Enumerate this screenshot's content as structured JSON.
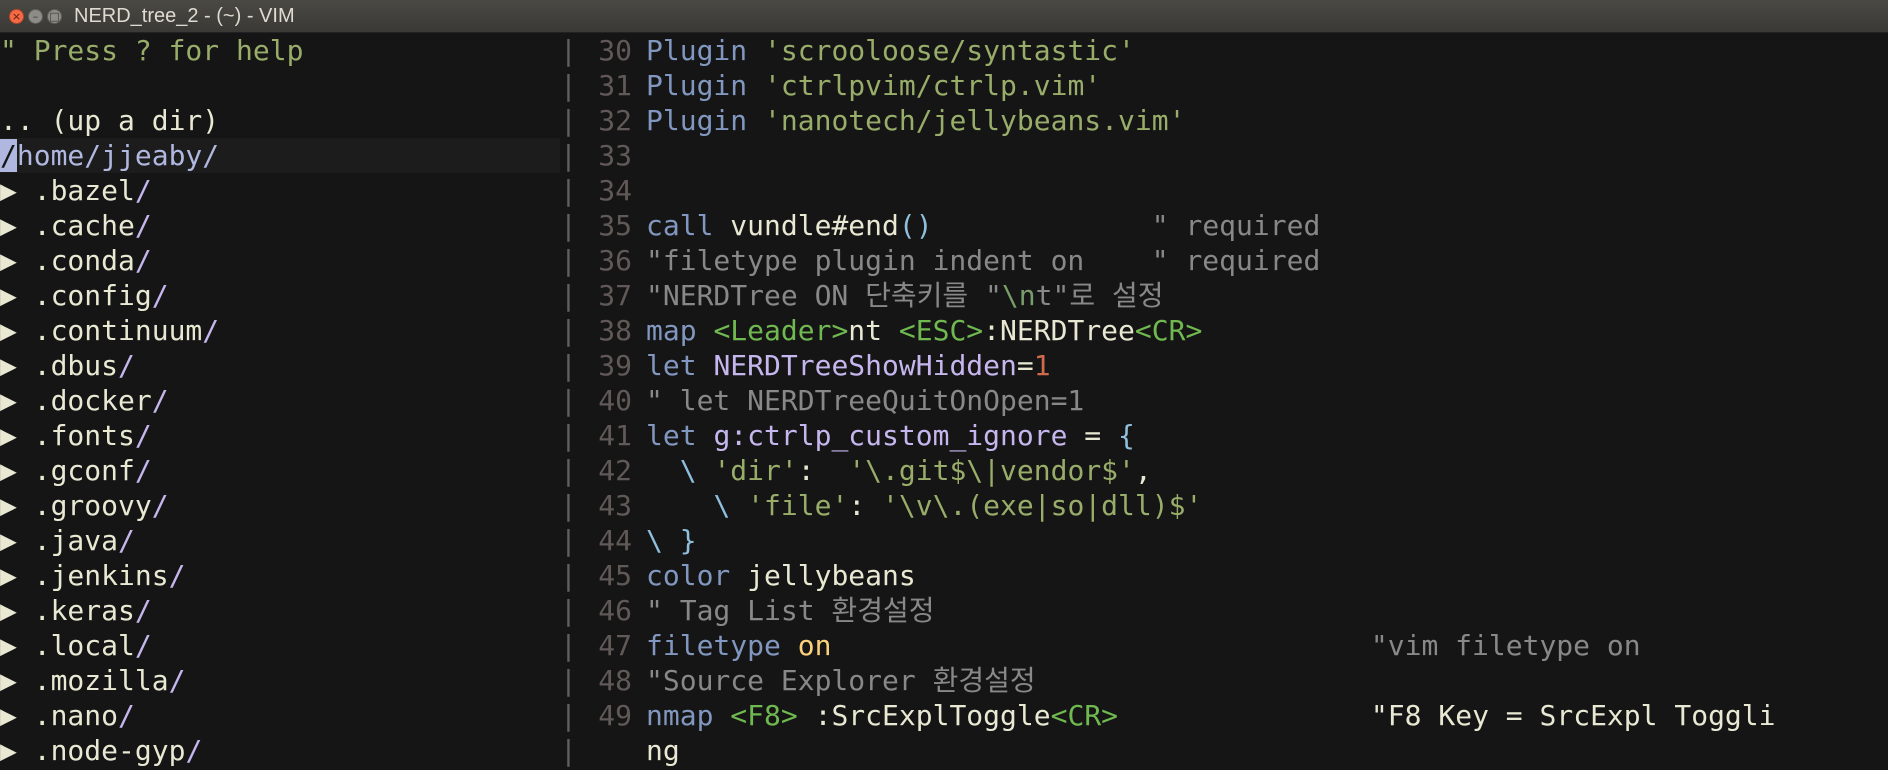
{
  "window": {
    "title": "NERD_tree_2 - (~) - VIM",
    "close_glyph": "×",
    "min_glyph": "–",
    "max_glyph": "□"
  },
  "tree": {
    "help_line": "\" Press ? for help",
    "up_dir": ".. (up a dir)",
    "root_cursor": "/",
    "root_rest": "home/jjeaby/",
    "arrow": "▶",
    "dirs": [
      ".bazel",
      ".cache",
      ".conda",
      ".config",
      ".continuum",
      ".dbus",
      ".docker",
      ".fonts",
      ".gconf",
      ".groovy",
      ".java",
      ".jenkins",
      ".keras",
      ".local",
      ".mozilla",
      ".nano",
      ".node-gyp"
    ]
  },
  "separator_char": "|",
  "code": {
    "line_numbers": [
      "30",
      "31",
      "32",
      "33",
      "34",
      "35",
      "36",
      "37",
      "38",
      "39",
      "40",
      "41",
      "42",
      "43",
      "44",
      "45",
      "46",
      "47",
      "48",
      "49",
      ""
    ],
    "l30": {
      "kw": "Plugin",
      "str": "'scrooloose/syntastic'"
    },
    "l31": {
      "kw": "Plugin",
      "str": "'ctrlpvim/ctrlp.vim'"
    },
    "l32": {
      "kw": "Plugin",
      "str": "'nanotech/jellybeans.vim'"
    },
    "l35": {
      "kw": "call",
      "fn": "vundle#end",
      "paren": "()",
      "cmt": "\" required"
    },
    "l36": {
      "cmt": "\"filetype plugin indent on    \" required"
    },
    "l37": {
      "cmt_a": "\"NERDTree ON 단축키를 \"",
      "esc": "\\n",
      "cmt_b": "t\"로 설정"
    },
    "l38": {
      "kw": "map",
      "tag1": "<Leader>",
      "plain1": "nt",
      "tag2": "<ESC>",
      "plain2": ":NERDTree",
      "tag3": "<CR>"
    },
    "l39": {
      "kw": "let",
      "var": "NERDTreeShowHidden",
      "op": "=",
      "num": "1"
    },
    "l40": {
      "cmt": "\" let NERDTreeQuitOnOpen=1"
    },
    "l41": {
      "kw": "let",
      "var": "g:ctrlp_custom_ignore",
      "op": " = ",
      "brace": "{"
    },
    "l42": {
      "bs": "\\",
      "key": "'dir'",
      "colon": ":",
      "val": "'\\.git$\\|vendor$'",
      "comma": ","
    },
    "l43": {
      "bs": "\\",
      "key": "'file'",
      "colon": ":",
      "val": "'\\v\\.(exe|so|dll)$'"
    },
    "l44": {
      "bs": "\\",
      "brace": "}"
    },
    "l45": {
      "kw": "color",
      "plain": "jellybeans"
    },
    "l46": {
      "cmt": "\" Tag List 환경설정"
    },
    "l47": {
      "kw": "filetype",
      "bool": "on",
      "cmt": "\"vim filetype on"
    },
    "l48": {
      "cmt": "\"Source Explorer 환경설정"
    },
    "l49": {
      "kw": "nmap",
      "tag1": "<F8>",
      "plain": ":SrcExplToggle",
      "tag2": "<CR>",
      "cmt": "\"F8 Key = SrcExpl Toggli"
    },
    "l49b": {
      "plain": "ng"
    }
  }
}
